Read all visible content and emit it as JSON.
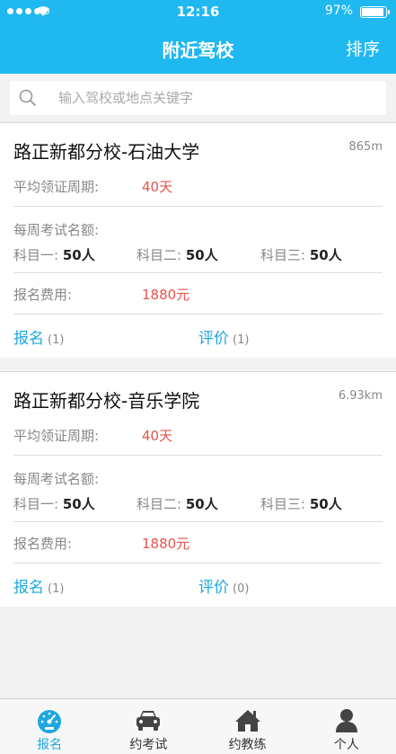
{
  "status": {
    "time": "12:16",
    "battery": "97%"
  },
  "nav": {
    "title": "附近驾校",
    "sort_label": "排序"
  },
  "search": {
    "placeholder": "输入驾校或地点关键字"
  },
  "cards": [
    {
      "name": "路正新都分校-石油大学",
      "distance": "865m",
      "period_label": "平均领证周期:",
      "period_value": "40天",
      "quota_label": "每周考试名额:",
      "subjects": [
        {
          "label": "科目一:",
          "value": "50人"
        },
        {
          "label": "科目二:",
          "value": "50人"
        },
        {
          "label": "科目三:",
          "value": "50人"
        }
      ],
      "fee_label": "报名费用:",
      "fee_value": "1880元",
      "signup_label": "报名",
      "signup_count": "(1)",
      "review_label": "评价",
      "review_count": "(1)"
    },
    {
      "name": "路正新都分校-音乐学院",
      "distance": "6.93km",
      "period_label": "平均领证周期:",
      "period_value": "40天",
      "quota_label": "每周考试名额:",
      "subjects": [
        {
          "label": "科目一:",
          "value": "50人"
        },
        {
          "label": "科目二:",
          "value": "50人"
        },
        {
          "label": "科目三:",
          "value": "50人"
        }
      ],
      "fee_label": "报名费用:",
      "fee_value": "1880元",
      "signup_label": "报名",
      "signup_count": "(1)",
      "review_label": "评价",
      "review_count": "(0)"
    }
  ],
  "tabs": [
    {
      "label": "报名",
      "icon": "speedometer-icon",
      "active": true
    },
    {
      "label": "约考试",
      "icon": "car-icon",
      "active": false
    },
    {
      "label": "约教练",
      "icon": "home-icon",
      "active": false
    },
    {
      "label": "个人",
      "icon": "person-icon",
      "active": false
    }
  ],
  "colors": {
    "primary": "#1fb8f0",
    "accent_text": "#1fa8e0",
    "highlight_red": "#e8534a"
  }
}
